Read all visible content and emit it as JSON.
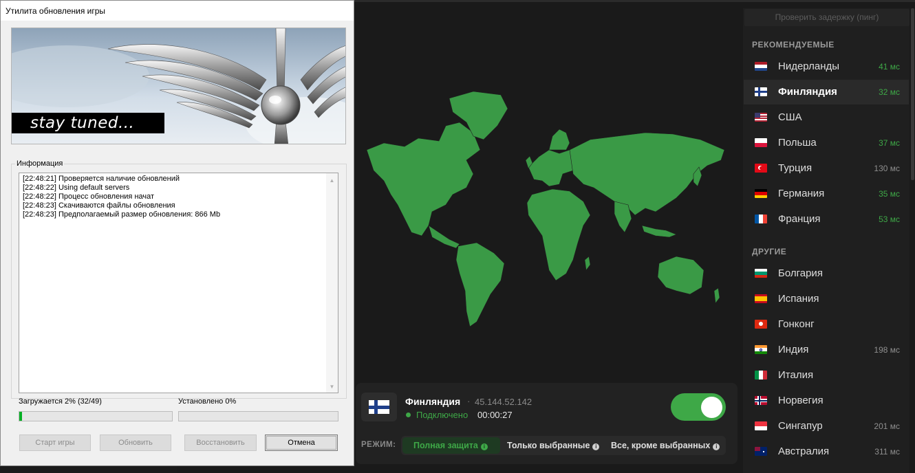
{
  "updater": {
    "title": "Утилита обновления игры",
    "banner_text": "stay tuned...",
    "info_legend": "Информация",
    "log": [
      "[22:48:21] Проверяется наличие обновлений",
      "[22:48:22] Using default servers",
      "[22:48:22] Процесс обновления начат",
      "[22:48:23] Скачиваются файлы обновления",
      "[22:48:23] Предполагаемый размер обновления: 866 Mb"
    ],
    "download_label": "Загружается 2% (32/49)",
    "download_progress": 0.02,
    "installed_label": "Установлено 0%",
    "installed_progress": 0,
    "buttons": {
      "start": "Старт игры",
      "update": "Обновить",
      "restore": "Восстановить",
      "cancel": "Отмена"
    }
  },
  "vpn": {
    "ping_button": "Проверить задержку (пинг)",
    "recommended_header": "РЕКОМЕНДУЕМЫЕ",
    "others_header": "ДРУГИЕ",
    "recommended": [
      {
        "name": "Нидерланды",
        "ping": "41 мс",
        "flag": "nl"
      },
      {
        "name": "Финляндия",
        "ping": "32 мс",
        "flag": "fi"
      },
      {
        "name": "США",
        "ping": "",
        "flag": "us"
      },
      {
        "name": "Польша",
        "ping": "37 мс",
        "flag": "pl"
      },
      {
        "name": "Турция",
        "ping": "130 мс",
        "flag": "tr"
      },
      {
        "name": "Германия",
        "ping": "35 мс",
        "flag": "de"
      },
      {
        "name": "Франция",
        "ping": "53 мс",
        "flag": "fr"
      }
    ],
    "others": [
      {
        "name": "Болгария",
        "ping": "",
        "flag": "bg"
      },
      {
        "name": "Испания",
        "ping": "",
        "flag": "es"
      },
      {
        "name": "Гонконг",
        "ping": "",
        "flag": "hk"
      },
      {
        "name": "Индия",
        "ping": "198 мс",
        "flag": "in"
      },
      {
        "name": "Италия",
        "ping": "",
        "flag": "it"
      },
      {
        "name": "Норвегия",
        "ping": "",
        "flag": "no"
      },
      {
        "name": "Сингапур",
        "ping": "201 мс",
        "flag": "sg"
      },
      {
        "name": "Австралия",
        "ping": "311 мс",
        "flag": "au"
      }
    ],
    "connection": {
      "country": "Финляндия",
      "separator": "·",
      "ip": "45.144.52.142",
      "status": "Подключено",
      "time": "00:00:27",
      "enabled": true
    },
    "mode": {
      "label": "РЕЖИМ:",
      "options": [
        "Полная защита",
        "Только выбранные",
        "Все, кроме выбранных"
      ],
      "active_index": 0
    },
    "colors": {
      "accent": "#3ea847",
      "map_land": "#3a9a46",
      "background": "#1a1a1a"
    }
  }
}
